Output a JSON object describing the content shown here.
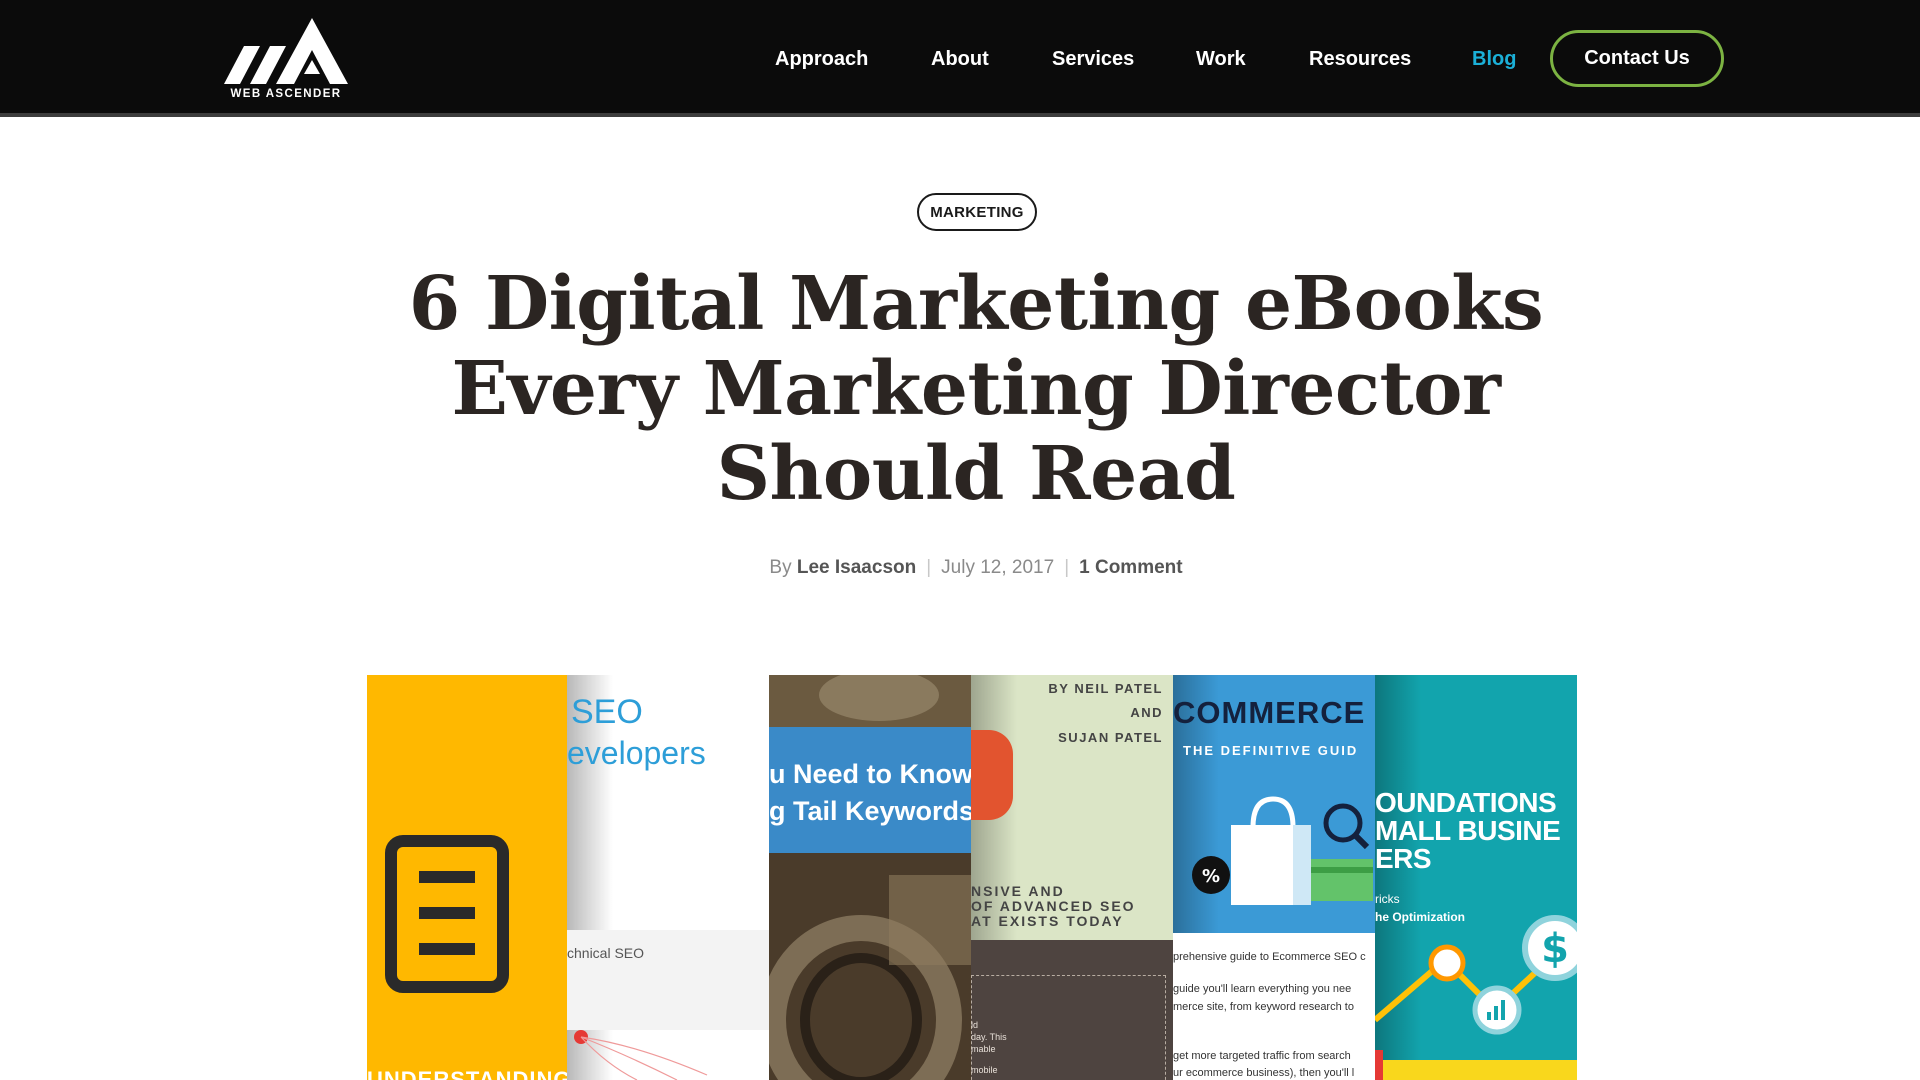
{
  "header": {
    "logo_text": "WEB ASCENDER",
    "nav": [
      {
        "label": "Approach",
        "active": false
      },
      {
        "label": "About",
        "active": false
      },
      {
        "label": "Services",
        "active": false
      },
      {
        "label": "Work",
        "active": false
      },
      {
        "label": "Resources",
        "active": false
      },
      {
        "label": "Blog",
        "active": true
      }
    ],
    "contact_label": "Contact Us"
  },
  "colors": {
    "header_bg": "#0b0b0b",
    "active_nav": "#1bb0d8",
    "contact_border": "#7cb342",
    "title": "#2b2522"
  },
  "post": {
    "category": "MARKETING",
    "title": "6 Digital Marketing eBooks Every Marketing Director Should Read",
    "meta": {
      "by": "By",
      "author": "Lee Isaacson",
      "date": "July 12, 2017",
      "comments": "1 Comment"
    }
  },
  "featured_image": {
    "covers": [
      {
        "name": "understanding-cover",
        "icon": "document-icon",
        "texts": [
          "UNDERSTANDING"
        ]
      },
      {
        "name": "seo-developers-cover",
        "texts": [
          "SEO",
          "evelopers",
          "chnical SEO"
        ]
      },
      {
        "name": "long-tail-cover",
        "texts": [
          "u Need to Know",
          "g Tail Keywords"
        ]
      },
      {
        "name": "advanced-seo-cover",
        "texts": [
          "BY NEIL PATEL",
          "AND",
          "SUJAN PATEL",
          "NSIVE AND",
          "OF ADVANCED SEO",
          "AT EXISTS TODAY",
          "ld",
          "day. This",
          "mable",
          "mobile"
        ]
      },
      {
        "name": "ecommerce-seo-cover",
        "icon": "shopping-bag-icon",
        "texts": [
          "COMMERCE S",
          "THE DEFINITIVE GUID",
          "prehensive guide to Ecommerce SEO c",
          "guide you'll learn everything you nee",
          "merce site, from keyword research to",
          "get more targeted traffic from search",
          "ur ecommerce business), then you'll l"
        ]
      },
      {
        "name": "foundations-cover",
        "icon": "dollar-icon",
        "texts": [
          "OUNDATIONS",
          "MALL BUSINE",
          "ERS",
          "ricks",
          "he Optimization"
        ]
      }
    ]
  }
}
